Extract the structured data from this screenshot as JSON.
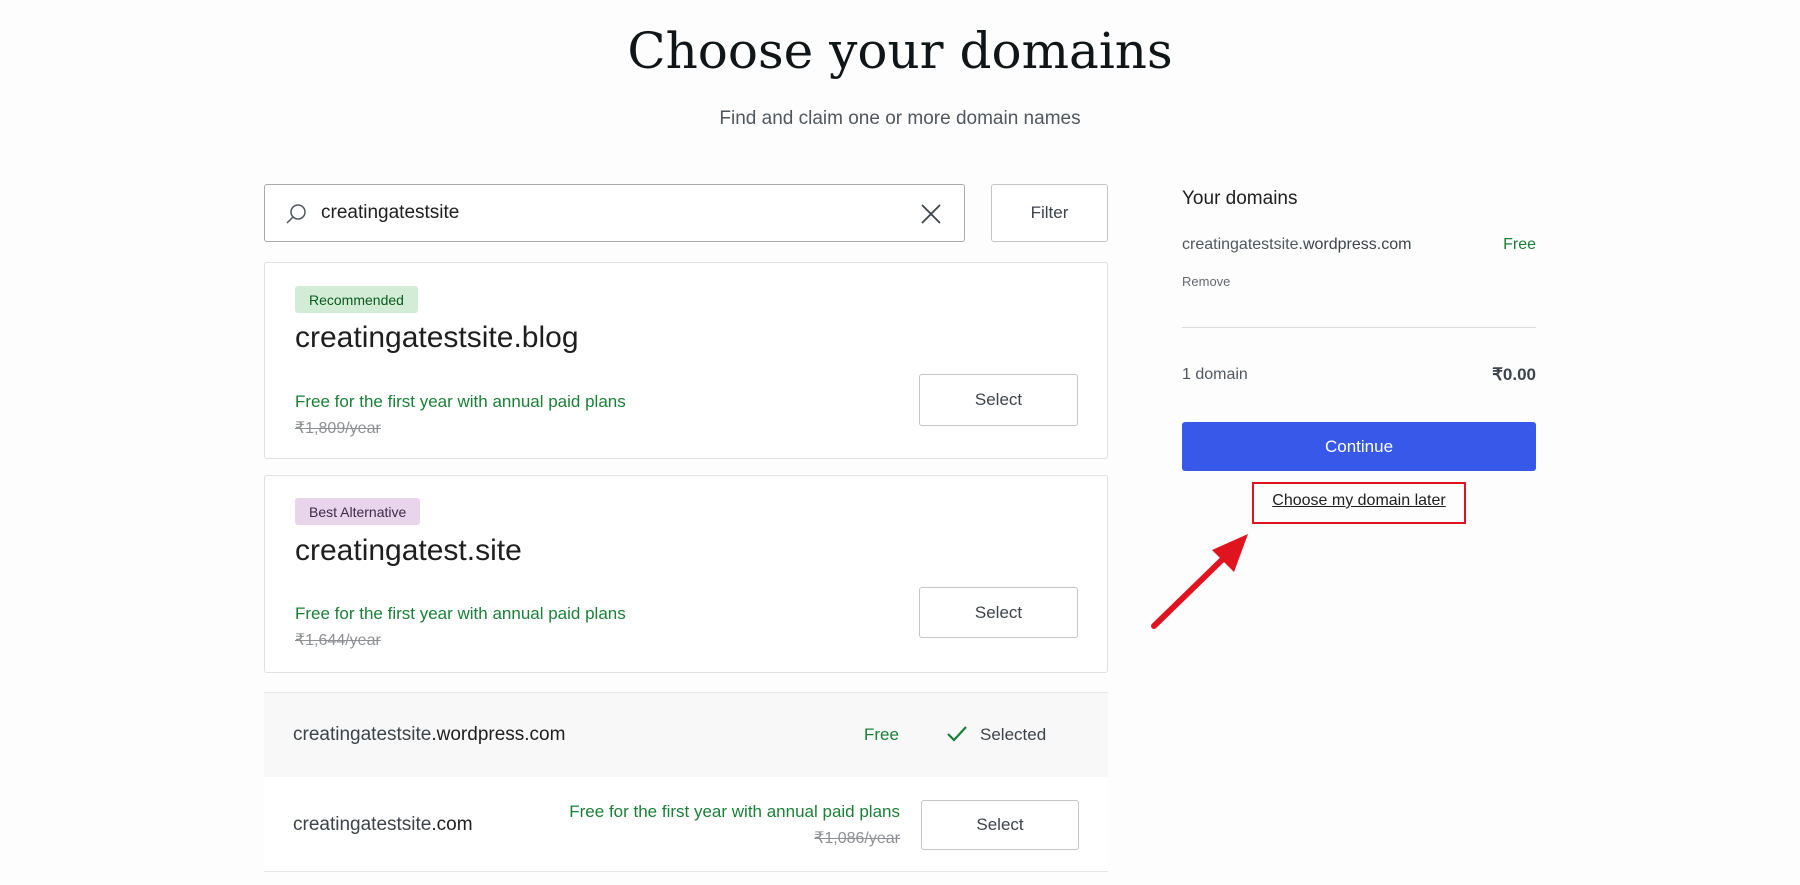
{
  "header": {
    "title": "Choose your domains",
    "subtitle": "Find and claim one or more domain names"
  },
  "search": {
    "value": "creatingatestsite",
    "filter_label": "Filter"
  },
  "featured": [
    {
      "badge": "Recommended",
      "badge_bg": "#d3ecd6",
      "badge_color": "#0b5b1e",
      "domain": "creatingatestsite.blog",
      "offer": "Free for the first year with annual paid plans",
      "price": "₹1,809/year",
      "button": "Select"
    },
    {
      "badge": "Best Alternative",
      "badge_bg": "#e8d5ec",
      "badge_color": "#3c2a48",
      "domain": "creatingatest.site",
      "offer": "Free for the first year with annual paid plans",
      "price": "₹1,644/year",
      "button": "Select"
    }
  ],
  "rows": [
    {
      "name": "creatingatestsite",
      "tld": ".wordpress.com",
      "price": "Free",
      "status": "Selected"
    },
    {
      "name": "creatingatestsite",
      "tld": ".com",
      "offer": "Free for the first year with annual paid plans",
      "price": "₹1,086/year",
      "button": "Select"
    }
  ],
  "sidebar": {
    "heading": "Your domains",
    "domain_name": "creatingatestsite",
    "domain_tld": ".wordpress.com",
    "domain_price": "Free",
    "remove": "Remove",
    "count": "1 domain",
    "total": "₹0.00",
    "continue": "Continue",
    "later": "Choose my domain later"
  },
  "colors": {
    "accent": "#3858e9",
    "green": "#1a7f37",
    "annotation": "#e0141e"
  }
}
